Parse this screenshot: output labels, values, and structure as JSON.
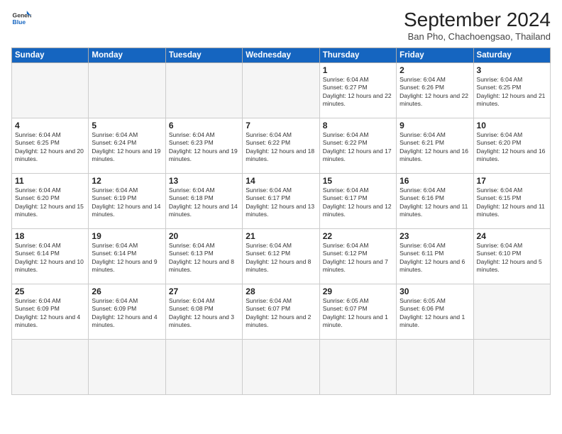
{
  "logo": {
    "line1": "General",
    "line2": "Blue"
  },
  "title": "September 2024",
  "subtitle": "Ban Pho, Chachoengsao, Thailand",
  "headers": [
    "Sunday",
    "Monday",
    "Tuesday",
    "Wednesday",
    "Thursday",
    "Friday",
    "Saturday"
  ],
  "days": [
    {
      "num": "",
      "empty": true
    },
    {
      "num": "",
      "empty": true
    },
    {
      "num": "",
      "empty": true
    },
    {
      "num": "",
      "empty": true
    },
    {
      "num": "1",
      "sunrise": "6:04 AM",
      "sunset": "6:27 PM",
      "daylight": "12 hours and 22 minutes."
    },
    {
      "num": "2",
      "sunrise": "6:04 AM",
      "sunset": "6:26 PM",
      "daylight": "12 hours and 22 minutes."
    },
    {
      "num": "3",
      "sunrise": "6:04 AM",
      "sunset": "6:25 PM",
      "daylight": "12 hours and 21 minutes."
    },
    {
      "num": "4",
      "sunrise": "6:04 AM",
      "sunset": "6:25 PM",
      "daylight": "12 hours and 20 minutes."
    },
    {
      "num": "5",
      "sunrise": "6:04 AM",
      "sunset": "6:24 PM",
      "daylight": "12 hours and 19 minutes."
    },
    {
      "num": "6",
      "sunrise": "6:04 AM",
      "sunset": "6:23 PM",
      "daylight": "12 hours and 19 minutes."
    },
    {
      "num": "7",
      "sunrise": "6:04 AM",
      "sunset": "6:22 PM",
      "daylight": "12 hours and 18 minutes."
    },
    {
      "num": "8",
      "sunrise": "6:04 AM",
      "sunset": "6:22 PM",
      "daylight": "12 hours and 17 minutes."
    },
    {
      "num": "9",
      "sunrise": "6:04 AM",
      "sunset": "6:21 PM",
      "daylight": "12 hours and 16 minutes."
    },
    {
      "num": "10",
      "sunrise": "6:04 AM",
      "sunset": "6:20 PM",
      "daylight": "12 hours and 16 minutes."
    },
    {
      "num": "11",
      "sunrise": "6:04 AM",
      "sunset": "6:20 PM",
      "daylight": "12 hours and 15 minutes."
    },
    {
      "num": "12",
      "sunrise": "6:04 AM",
      "sunset": "6:19 PM",
      "daylight": "12 hours and 14 minutes."
    },
    {
      "num": "13",
      "sunrise": "6:04 AM",
      "sunset": "6:18 PM",
      "daylight": "12 hours and 14 minutes."
    },
    {
      "num": "14",
      "sunrise": "6:04 AM",
      "sunset": "6:17 PM",
      "daylight": "12 hours and 13 minutes."
    },
    {
      "num": "15",
      "sunrise": "6:04 AM",
      "sunset": "6:17 PM",
      "daylight": "12 hours and 12 minutes."
    },
    {
      "num": "16",
      "sunrise": "6:04 AM",
      "sunset": "6:16 PM",
      "daylight": "12 hours and 11 minutes."
    },
    {
      "num": "17",
      "sunrise": "6:04 AM",
      "sunset": "6:15 PM",
      "daylight": "12 hours and 11 minutes."
    },
    {
      "num": "18",
      "sunrise": "6:04 AM",
      "sunset": "6:14 PM",
      "daylight": "12 hours and 10 minutes."
    },
    {
      "num": "19",
      "sunrise": "6:04 AM",
      "sunset": "6:14 PM",
      "daylight": "12 hours and 9 minutes."
    },
    {
      "num": "20",
      "sunrise": "6:04 AM",
      "sunset": "6:13 PM",
      "daylight": "12 hours and 8 minutes."
    },
    {
      "num": "21",
      "sunrise": "6:04 AM",
      "sunset": "6:12 PM",
      "daylight": "12 hours and 8 minutes."
    },
    {
      "num": "22",
      "sunrise": "6:04 AM",
      "sunset": "6:12 PM",
      "daylight": "12 hours and 7 minutes."
    },
    {
      "num": "23",
      "sunrise": "6:04 AM",
      "sunset": "6:11 PM",
      "daylight": "12 hours and 6 minutes."
    },
    {
      "num": "24",
      "sunrise": "6:04 AM",
      "sunset": "6:10 PM",
      "daylight": "12 hours and 5 minutes."
    },
    {
      "num": "25",
      "sunrise": "6:04 AM",
      "sunset": "6:09 PM",
      "daylight": "12 hours and 4 minutes."
    },
    {
      "num": "26",
      "sunrise": "6:04 AM",
      "sunset": "6:09 PM",
      "daylight": "12 hours and 4 minutes."
    },
    {
      "num": "27",
      "sunrise": "6:04 AM",
      "sunset": "6:08 PM",
      "daylight": "12 hours and 3 minutes."
    },
    {
      "num": "28",
      "sunrise": "6:04 AM",
      "sunset": "6:07 PM",
      "daylight": "12 hours and 2 minutes."
    },
    {
      "num": "29",
      "sunrise": "6:05 AM",
      "sunset": "6:07 PM",
      "daylight": "12 hours and 1 minute."
    },
    {
      "num": "30",
      "sunrise": "6:05 AM",
      "sunset": "6:06 PM",
      "daylight": "12 hours and 1 minute."
    },
    {
      "num": "",
      "empty": true
    },
    {
      "num": "",
      "empty": true
    },
    {
      "num": "",
      "empty": true
    },
    {
      "num": "",
      "empty": true
    },
    {
      "num": "",
      "empty": true
    }
  ]
}
